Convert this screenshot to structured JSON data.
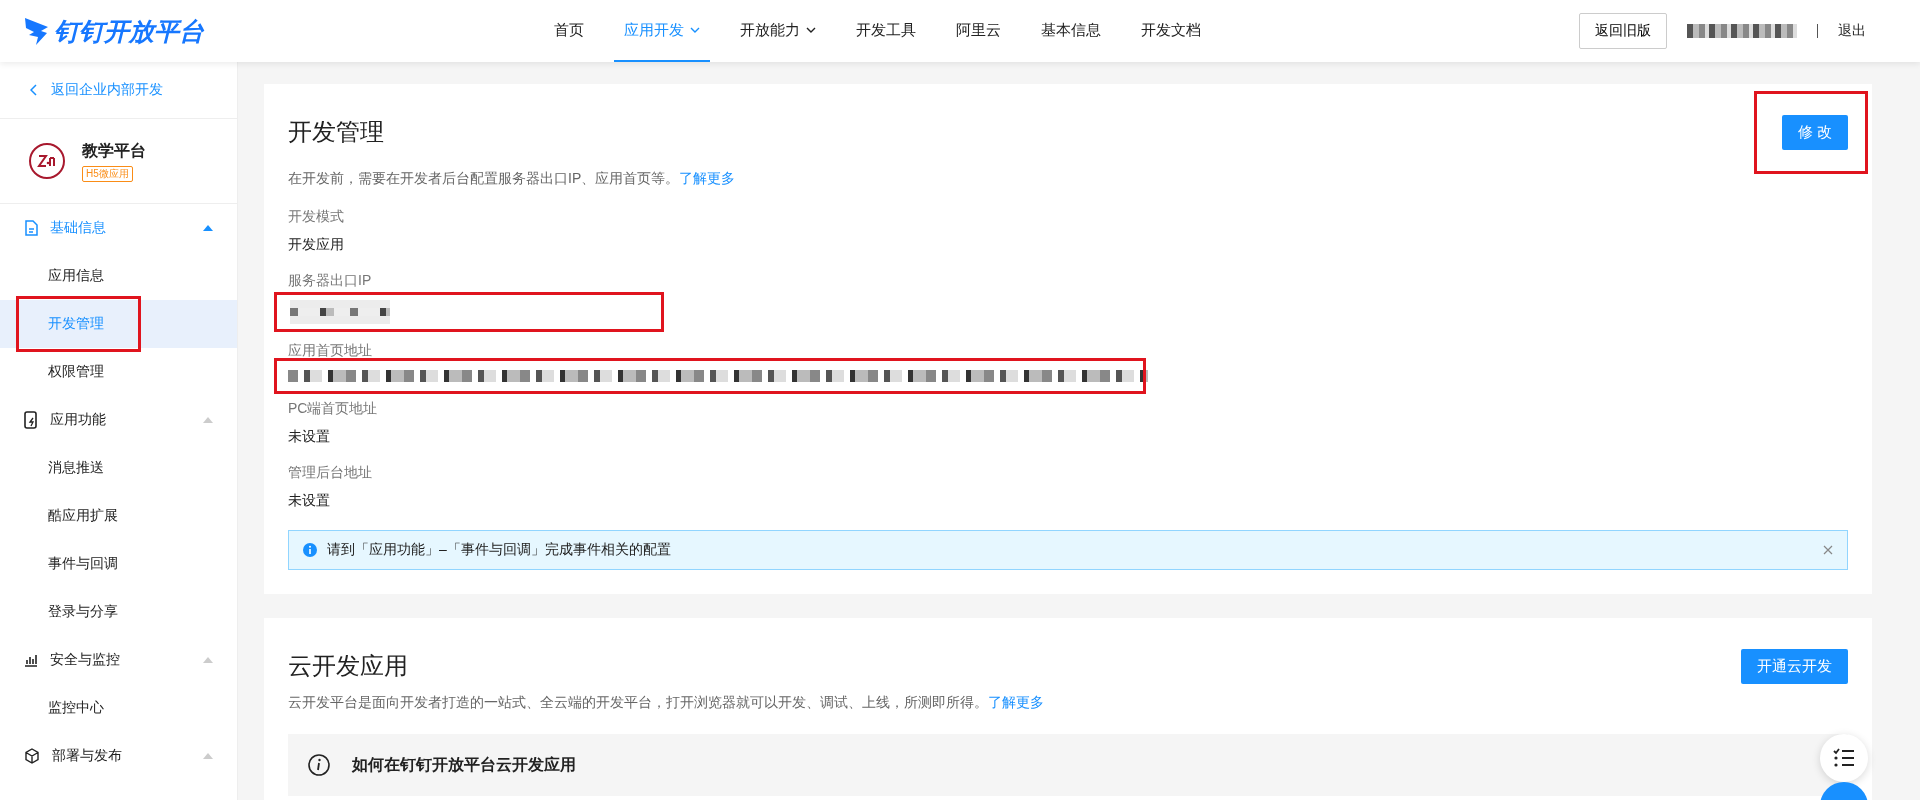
{
  "header": {
    "logo": "钉钉开放平台",
    "nav": [
      {
        "label": "首页",
        "selected": false,
        "dropdown": false
      },
      {
        "label": "应用开发",
        "selected": true,
        "dropdown": true
      },
      {
        "label": "开放能力",
        "selected": false,
        "dropdown": true
      },
      {
        "label": "开发工具",
        "selected": false,
        "dropdown": false
      },
      {
        "label": "阿里云",
        "selected": false,
        "dropdown": false
      },
      {
        "label": "基本信息",
        "selected": false,
        "dropdown": false
      },
      {
        "label": "开发文档",
        "selected": false,
        "dropdown": false
      }
    ],
    "old_version_button": "返回旧版",
    "logout": "退出"
  },
  "sidebar": {
    "back_link": "返回企业内部开发",
    "app": {
      "name": "教学平台",
      "tag": "H5微应用"
    },
    "groups": [
      {
        "label": "基础信息",
        "expanded": true,
        "children": [
          {
            "label": "应用信息",
            "selected": false,
            "highlighted": false
          },
          {
            "label": "开发管理",
            "selected": true,
            "highlighted": true
          },
          {
            "label": "权限管理",
            "selected": false,
            "highlighted": false
          }
        ]
      },
      {
        "label": "应用功能",
        "expanded": true,
        "children": [
          {
            "label": "消息推送",
            "selected": false,
            "highlighted": false
          },
          {
            "label": "酷应用扩展",
            "selected": false,
            "highlighted": false
          },
          {
            "label": "事件与回调",
            "selected": false,
            "highlighted": false
          },
          {
            "label": "登录与分享",
            "selected": false,
            "highlighted": false
          }
        ]
      },
      {
        "label": "安全与监控",
        "expanded": true,
        "children": [
          {
            "label": "监控中心",
            "selected": false,
            "highlighted": false
          }
        ]
      },
      {
        "label": "部署与发布",
        "expanded": true
      }
    ]
  },
  "dev_section": {
    "title": "开发管理",
    "edit_button": {
      "label": "修 改",
      "highlighted": true
    },
    "description": "在开发前，需要在开发者后台配置服务器出口IP、应用首页等。",
    "learn_more": "了解更多",
    "fields": [
      {
        "label": "开发模式",
        "kind": "text",
        "value": "开发应用",
        "highlighted": false
      },
      {
        "label": "服务器出口IP",
        "kind": "redacted_ip",
        "highlighted": true
      },
      {
        "label": "应用首页地址",
        "kind": "redacted_url",
        "highlighted": true
      },
      {
        "label": "PC端首页地址",
        "kind": "text",
        "value": "未设置",
        "highlighted": false
      },
      {
        "label": "管理后台地址",
        "kind": "text",
        "value": "未设置",
        "highlighted": false
      }
    ],
    "notice": {
      "text": "请到「应用功能」–「事件与回调」完成事件相关的配置",
      "closable": true
    }
  },
  "cloud_section": {
    "title": "云开发应用",
    "button": "开通云开发",
    "description": "云开发平台是面向开发者打造的一站式、全云端的开发平台，打开浏览器就可以开发、调试、上线，所测即所得。",
    "learn_more": "了解更多",
    "guide_title": "如何在钉钉开放平台云开发应用"
  }
}
